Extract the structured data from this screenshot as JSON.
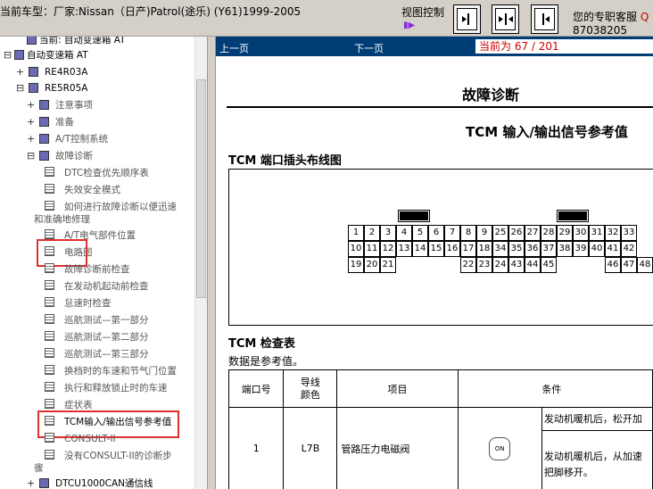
{
  "header": {
    "vehicle_label": "当前车型：厂家:Nissan（日产)Patrol(途乐) (Y61)1999-2005",
    "view_control_label": "视图控制",
    "view_buttons": [
      "nav-forward-icon",
      "split-view-icon",
      "nav-back-icon"
    ],
    "support_label": "您的专职客服",
    "support_link": "Q",
    "support_phone": "87038205"
  },
  "tree": {
    "items": [
      {
        "label": "当前: 自动变速箱 AT",
        "level": 1
      },
      {
        "label": "自动变速箱 AT",
        "level": 0
      },
      {
        "label": "RE4R03A",
        "level": 1
      },
      {
        "label": "RE5R05A",
        "level": 1
      },
      {
        "label": "注意事项",
        "level": 2
      },
      {
        "label": "准备",
        "level": 2
      },
      {
        "label": "A/T控制系统",
        "level": 2
      },
      {
        "label": "故障诊断",
        "level": 2
      },
      {
        "label": "DTC检查优先顺序表",
        "level": 3
      },
      {
        "label": "失效安全模式",
        "level": 3
      },
      {
        "label": "如何进行故障诊断以便迅速",
        "level": 3
      },
      {
        "label": "和准确地修理",
        "level": 3
      },
      {
        "label": "A/T电气部件位置",
        "level": 3
      },
      {
        "label": "电路图",
        "level": 3
      },
      {
        "label": "故障诊断前检查",
        "level": 3
      },
      {
        "label": "在发动机起动前检查",
        "level": 3
      },
      {
        "label": "怠速时检查",
        "level": 3
      },
      {
        "label": "巡航测试—第一部分",
        "level": 3
      },
      {
        "label": "巡航测试—第二部分",
        "level": 3
      },
      {
        "label": "巡航测试—第三部分",
        "level": 3
      },
      {
        "label": "换档时的车速和节气门位置",
        "level": 3
      },
      {
        "label": "执行和释放锁止时的车速",
        "level": 3
      },
      {
        "label": "症状表",
        "level": 3
      },
      {
        "label": "TCM输入/输出信号参考值",
        "level": 3
      },
      {
        "label": "CONSULT-II",
        "level": 3
      },
      {
        "label": "没有CONSULT-II的诊断步",
        "level": 3
      },
      {
        "label": "骤",
        "level": 3
      },
      {
        "label": "DTCU1000CAN通信线",
        "level": 2
      }
    ]
  },
  "nav": {
    "prev_label": "上一页",
    "next_label": "下一页",
    "page_indicator": "当前为 67 / 201"
  },
  "document": {
    "section_title": "故障诊断",
    "table_title": "TCM 输入/输出信号参考值",
    "connector_title": "TCM 端口插头布线图",
    "connector_rows": [
      [
        "1",
        "2",
        "3",
        "4",
        "5",
        "6",
        "7",
        "8",
        "9",
        "25",
        "26",
        "27",
        "28",
        "29",
        "30",
        "31",
        "32",
        "33"
      ],
      [
        "10",
        "11",
        "12",
        "13",
        "14",
        "15",
        "16",
        "17",
        "18",
        "34",
        "35",
        "36",
        "37",
        "38",
        "39",
        "40",
        "41",
        "42"
      ],
      [
        "19",
        "20",
        "21",
        "",
        "",
        "",
        "",
        "22",
        "23",
        "24",
        "43",
        "44",
        "45",
        "",
        "",
        "",
        "46",
        "47",
        "48"
      ]
    ],
    "check_title": "TCM 检查表",
    "check_note": "数据是参考值。",
    "table_headers": [
      "端口号",
      "导线颜色",
      "项目",
      "条件"
    ],
    "rows": [
      {
        "terminal": "1",
        "wire_color": "L7B",
        "item": "管路压力电磁阀",
        "icon": "accelerator-pedal-icon",
        "icon_label": "ON",
        "conditions": [
          "发动机暖机后，松开加",
          "发动机暖机后，从加速",
          "把脚移开。"
        ]
      }
    ]
  }
}
